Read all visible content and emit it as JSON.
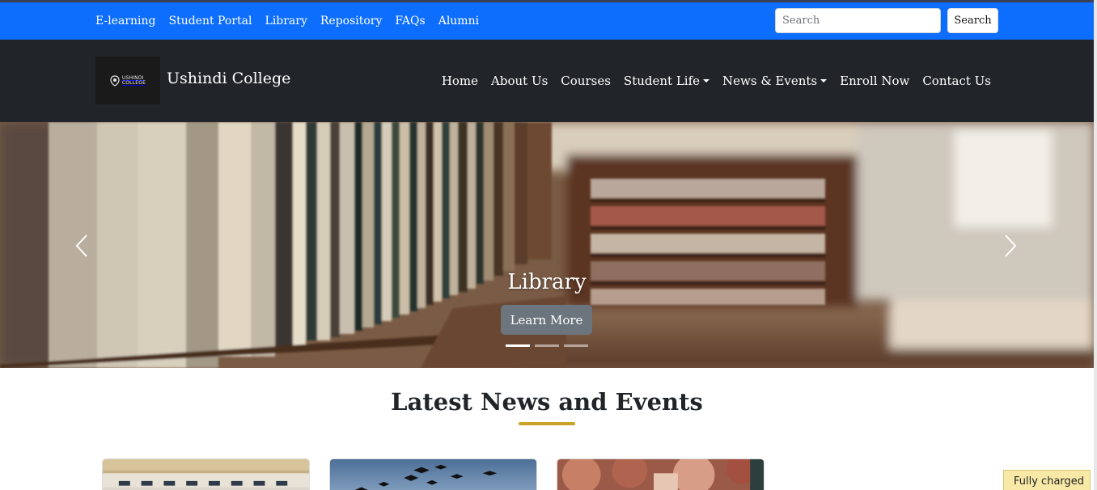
{
  "topbar": {
    "links": [
      "E-learning",
      "Student Portal",
      "Library",
      "Repository",
      "FAQs",
      "Alumni"
    ],
    "search_placeholder": "Search",
    "search_button": "Search"
  },
  "navbar": {
    "logo_text_line1": "USHINDI",
    "logo_text_line2": "COLLEGE",
    "brand": "Ushindi College",
    "links": [
      "Home",
      "About Us",
      "Courses",
      "Student Life",
      "News & Events",
      "Enroll Now",
      "Contact Us"
    ]
  },
  "hero": {
    "caption": "Library",
    "button": "Learn More",
    "active_slide": 1,
    "slide_count": 3
  },
  "news": {
    "title": "Latest News and Events"
  },
  "system": {
    "battery_tooltip": "Fully charged"
  },
  "colors": {
    "topbar": "#0d6efd",
    "navbar": "#212529",
    "accent_gold": "#c9a227",
    "button_grey": "#6c757d"
  }
}
